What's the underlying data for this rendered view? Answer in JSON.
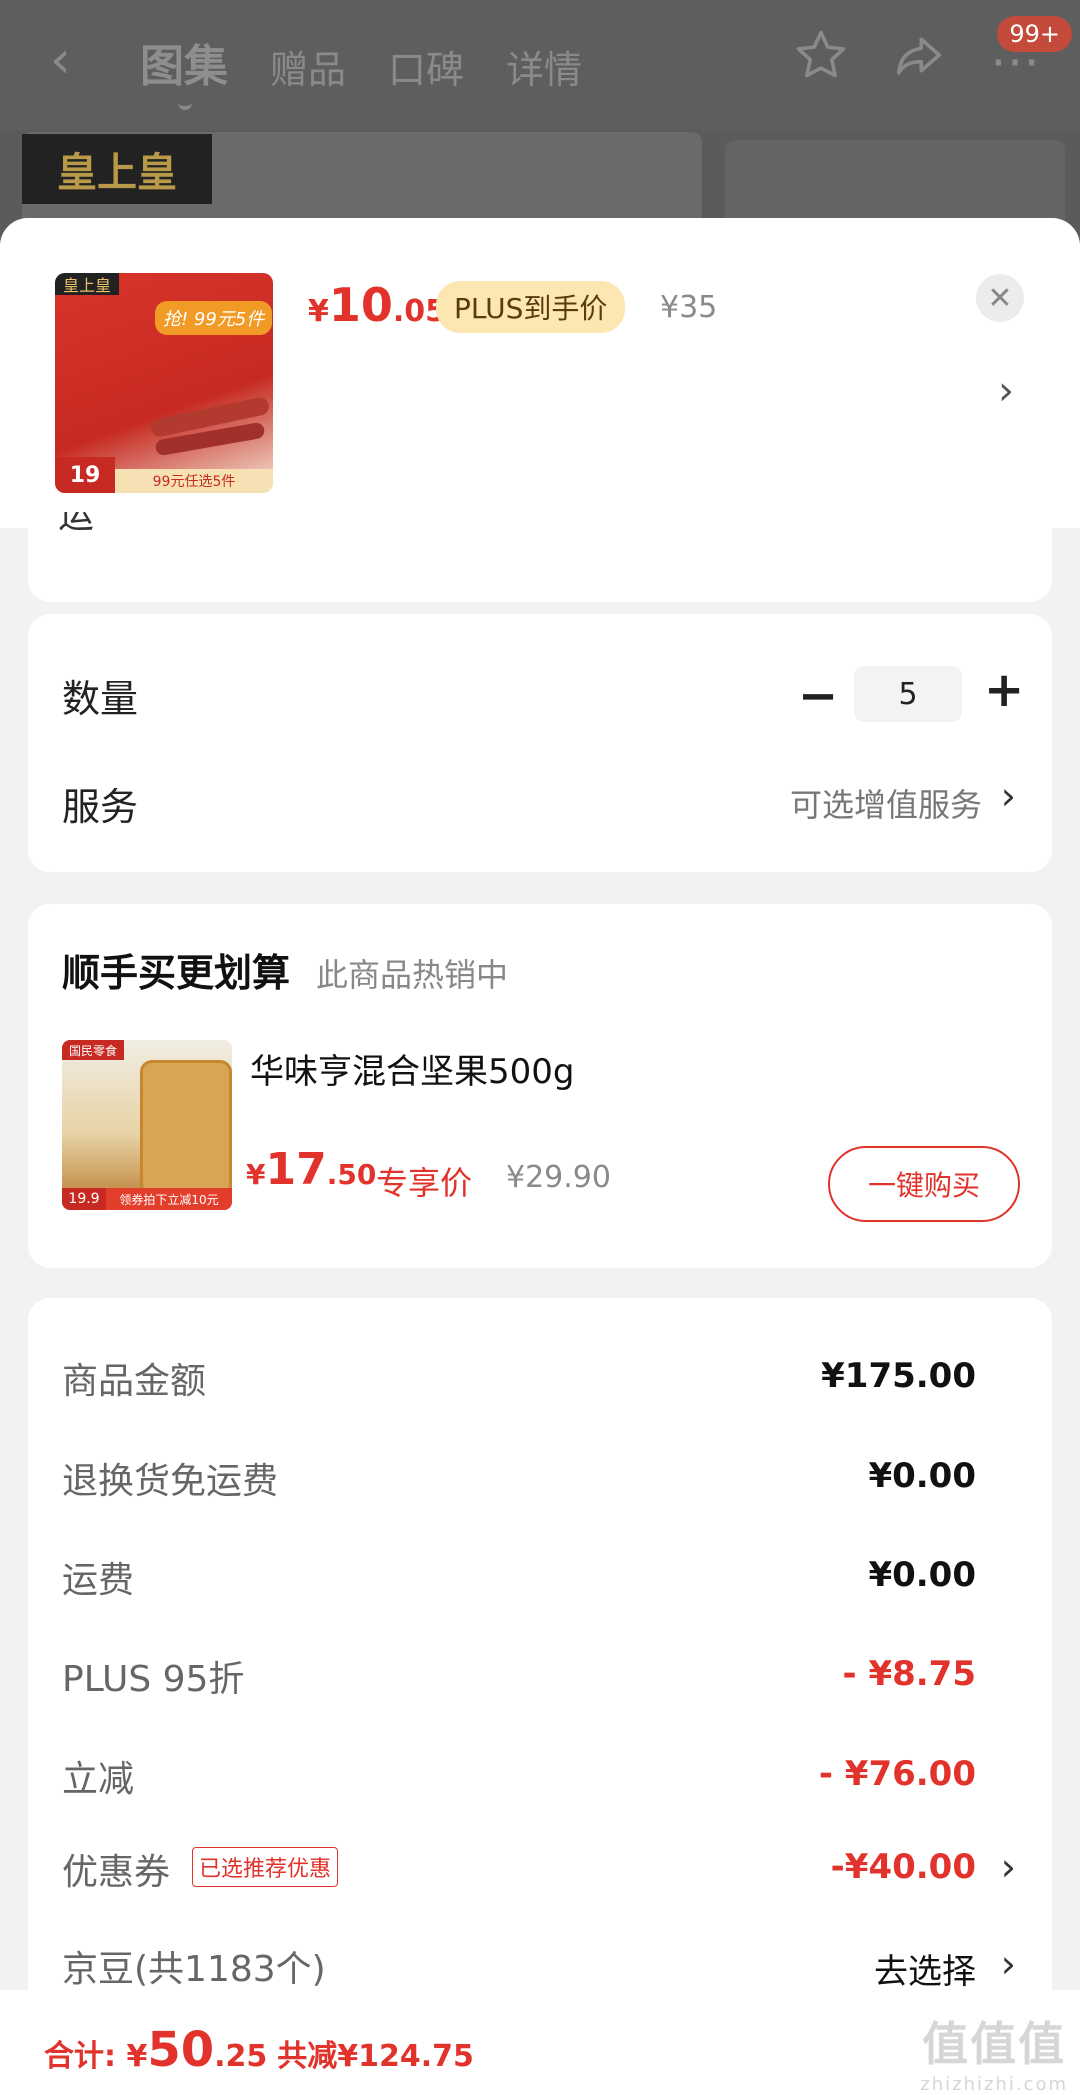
{
  "topbar": {
    "tabs": [
      "图集",
      "赠品",
      "口碑",
      "详情"
    ],
    "badge": "99+"
  },
  "background": {
    "brand_logo": "皇上皇"
  },
  "header": {
    "product_brand_logo": "皇上皇",
    "product_promo_burst": "抢! 99元5件",
    "product_thumb_price": "19",
    "product_thumb_promo": "99元任选5件",
    "price_symbol": "¥",
    "price_int": "10",
    "price_dec": ".05",
    "price_tag": "PLUS到手价",
    "original_price": "¥35"
  },
  "cut_text": "运",
  "quantity": {
    "label": "数量",
    "value": "5",
    "minus": "−",
    "plus": "+"
  },
  "service": {
    "label": "服务",
    "value": "可选增值服务"
  },
  "bundle": {
    "title": "顺手买更划算",
    "subtitle": "此商品热销中",
    "item": {
      "thumb_tag": "国民零食",
      "thumb_price": "19.9",
      "thumb_bar": "领券拍下立减10元",
      "name": "华味亨混合坚果500g",
      "price_symbol": "¥",
      "price_int": "17",
      "price_dec": ".50",
      "price_tag": "专享价",
      "original_price": "¥29.90",
      "button": "一键购买"
    }
  },
  "summary": {
    "rows": [
      {
        "label": "商品金额",
        "value": "¥175.00"
      },
      {
        "label": "退换货免运费",
        "value": "¥0.00"
      },
      {
        "label": "运费",
        "value": "¥0.00"
      },
      {
        "label": "PLUS 95折",
        "value": "- ¥8.75"
      },
      {
        "label": "立减",
        "value": "- ¥76.00"
      },
      {
        "label": "优惠券",
        "tag": "已选推荐优惠",
        "value": "-¥40.00"
      },
      {
        "label": "京豆(共1183个)",
        "value": "去选择"
      }
    ]
  },
  "footer": {
    "total_label": "合计: ",
    "total_symbol": "¥",
    "total_int": "50",
    "total_dec": ".25",
    "saved": "共减¥124.75"
  },
  "watermark": {
    "big": "值值值",
    "small": "zhizhizhi.com"
  },
  "colors": {
    "accent_red": "#e1332b",
    "plus_gold": "#fce7b2",
    "sheet_bg": "#f2f2f2"
  },
  "icons": [
    "back-icon",
    "star-icon",
    "share-icon",
    "more-icon",
    "close-icon",
    "chevron-right-icon",
    "minus-icon",
    "plus-icon"
  ]
}
